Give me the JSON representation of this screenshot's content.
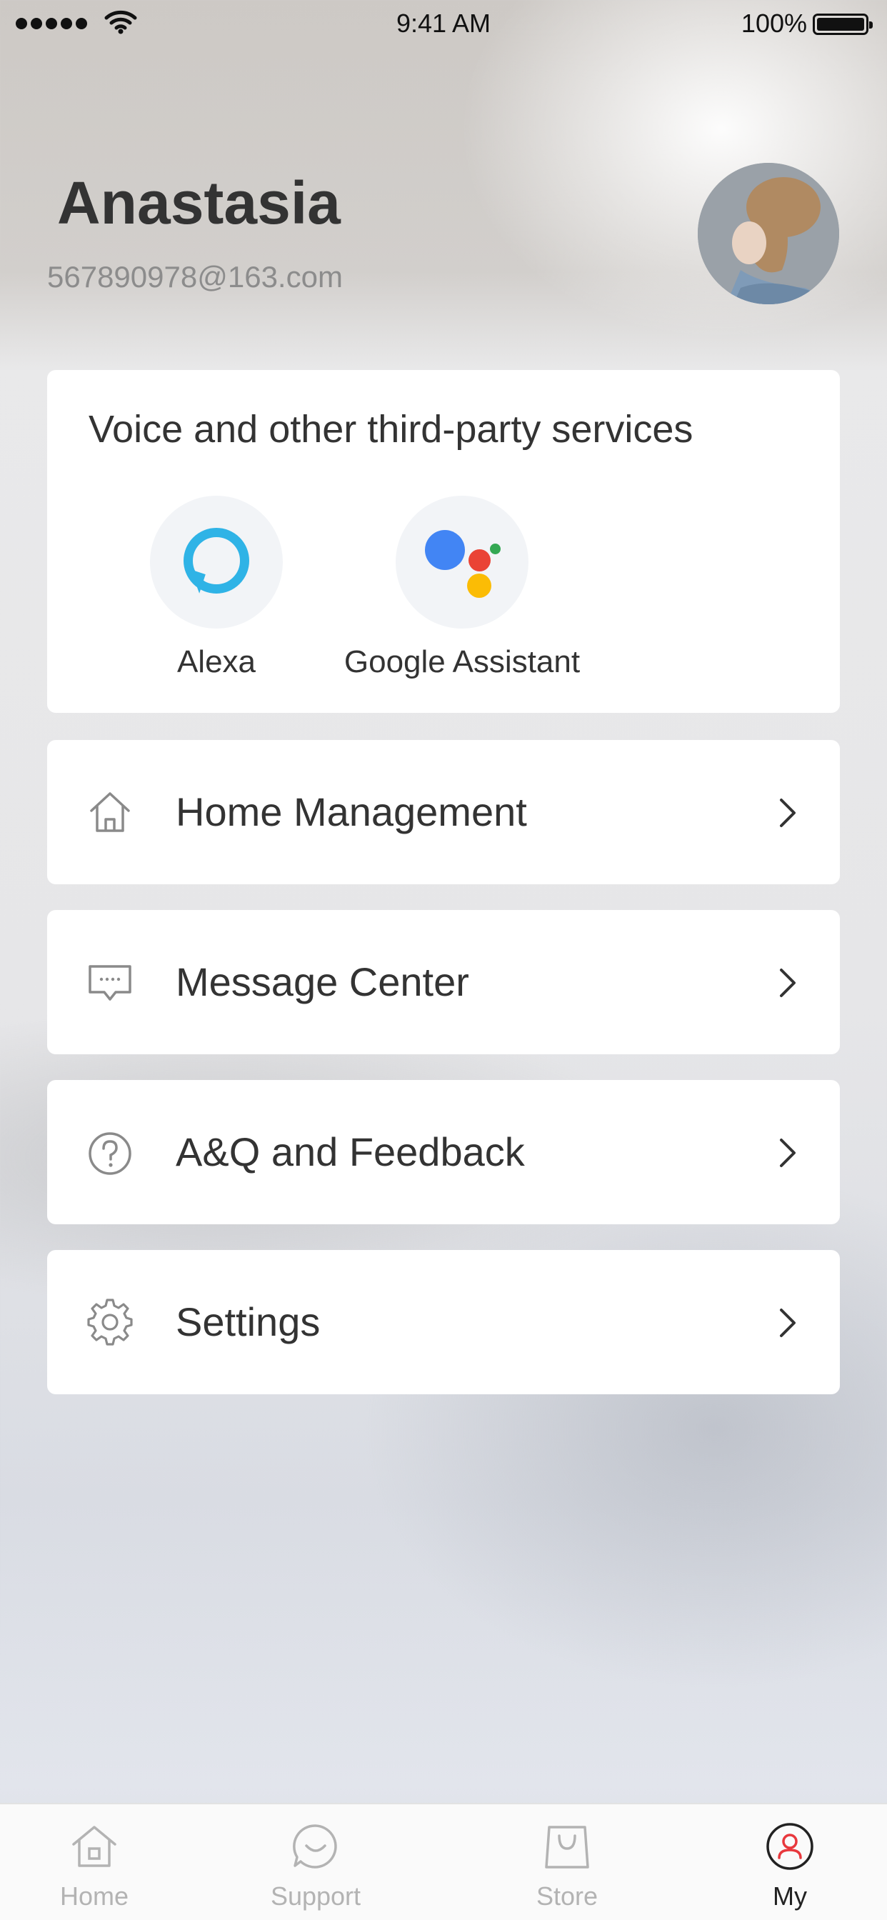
{
  "status_bar": {
    "time": "9:41 AM",
    "battery": "100%"
  },
  "profile": {
    "name": "Anastasia",
    "email": "567890978@163.com"
  },
  "voice_services": {
    "title": "Voice and other third-party services",
    "items": [
      {
        "label": "Alexa",
        "icon": "alexa-icon"
      },
      {
        "label": "Google Assistant",
        "icon": "google-assistant-icon"
      }
    ]
  },
  "menu": [
    {
      "label": "Home Management",
      "icon": "house-icon"
    },
    {
      "label": "Message Center",
      "icon": "message-icon"
    },
    {
      "label": "A&Q and Feedback",
      "icon": "question-icon"
    },
    {
      "label": "Settings",
      "icon": "gear-icon"
    }
  ],
  "tab_bar": {
    "tabs": [
      {
        "label": "Home",
        "icon": "house-icon",
        "active": false
      },
      {
        "label": "Support",
        "icon": "chat-icon",
        "active": false
      },
      {
        "label": "Store",
        "icon": "shopping-bag-icon",
        "active": false
      },
      {
        "label": "My",
        "icon": "person-icon",
        "active": true
      }
    ],
    "active_color": "#e8383d",
    "inactive_color": "#b3b3b3"
  }
}
